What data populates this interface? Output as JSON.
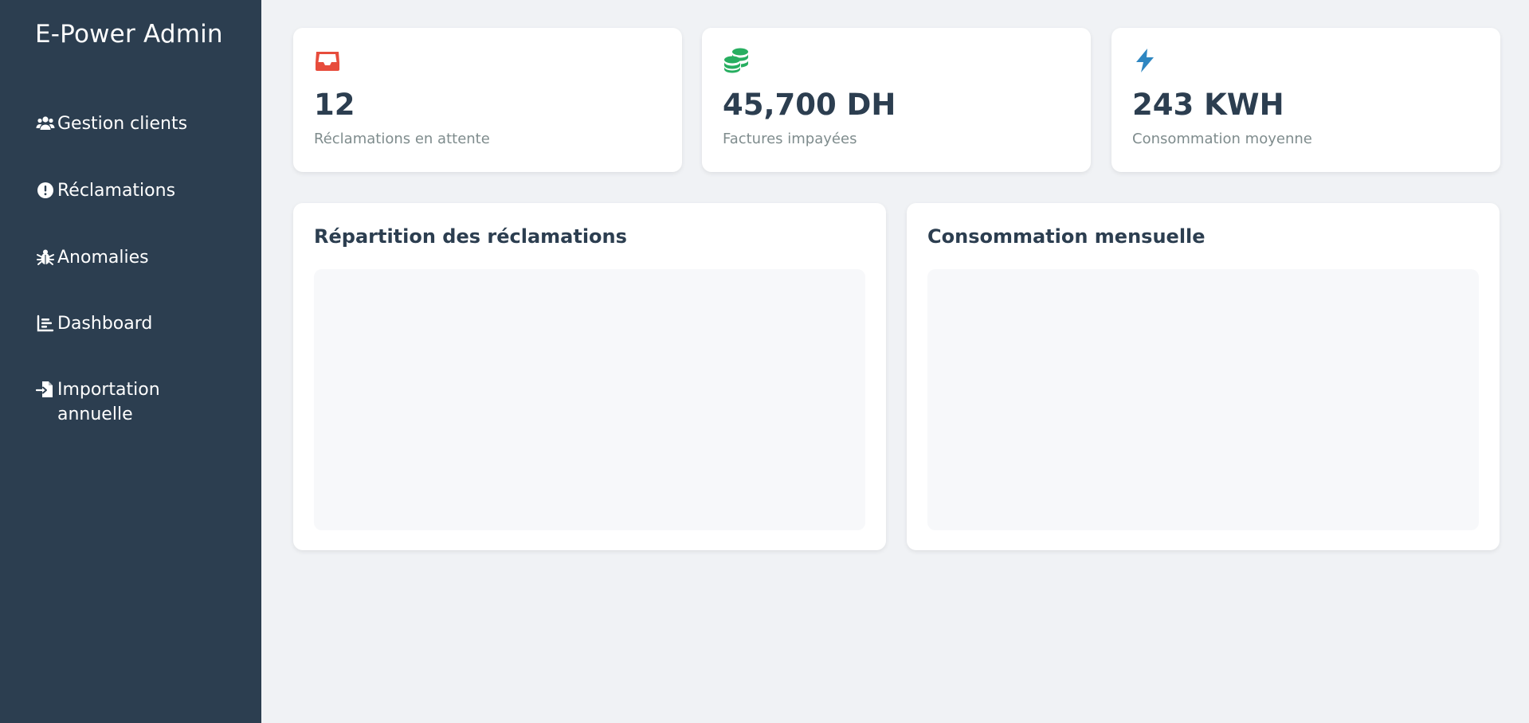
{
  "sidebar": {
    "brand": "E-Power Admin",
    "items": [
      {
        "label": "Gestion clients",
        "icon": "users-icon"
      },
      {
        "label": "Réclamations",
        "icon": "exclamation-circle-icon"
      },
      {
        "label": "Anomalies",
        "icon": "bug-icon"
      },
      {
        "label": "Dashboard",
        "icon": "chart-bar-icon"
      },
      {
        "label": "Importation annuelle",
        "icon": "file-import-icon"
      }
    ]
  },
  "stats": [
    {
      "value": "12",
      "label": "Réclamations en attente",
      "icon": "inbox-icon",
      "color": "#e74c3c"
    },
    {
      "value": "45,700 DH",
      "label": "Factures impayées",
      "icon": "coins-icon",
      "color": "#27ae60"
    },
    {
      "value": "243 KWH",
      "label": "Consommation moyenne",
      "icon": "bolt-icon",
      "color": "#2e86c1"
    }
  ],
  "charts": [
    {
      "title": "Répartition des réclamations"
    },
    {
      "title": "Consommation mensuelle"
    }
  ],
  "colors": {
    "sidebar_bg": "#2c3e50",
    "page_bg": "#f0f2f5",
    "heading": "#2c3e50",
    "muted": "#7f8c8d"
  }
}
